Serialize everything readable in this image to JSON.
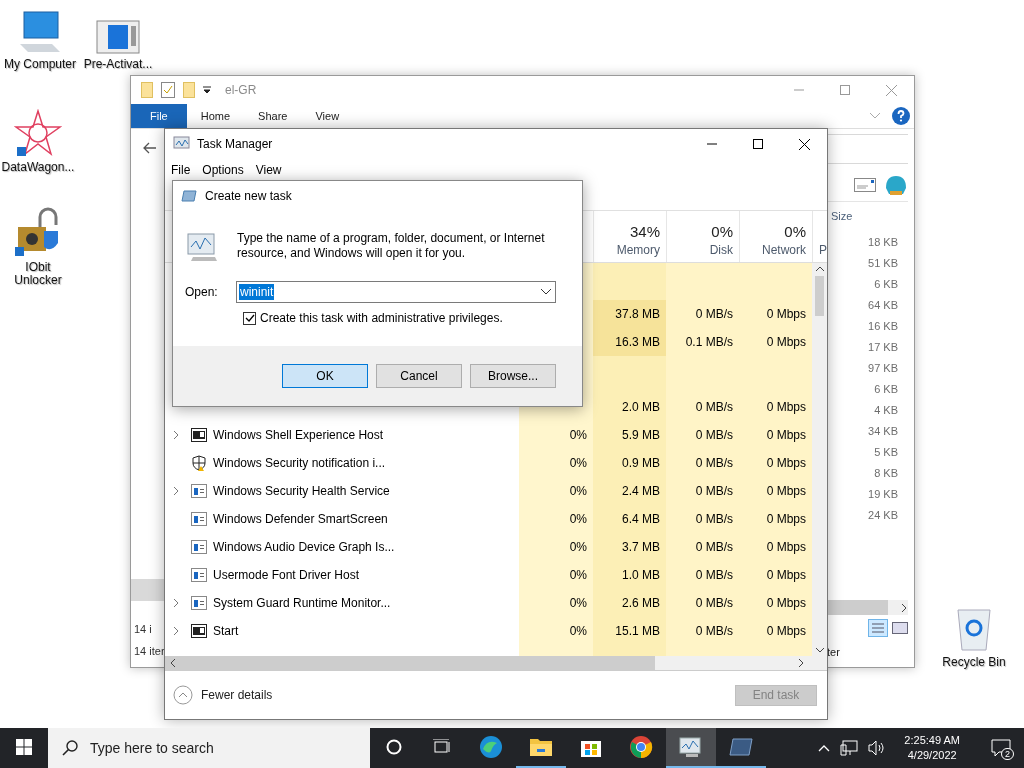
{
  "desktop_icons": [
    {
      "label": "My Computer",
      "kind": "computer"
    },
    {
      "label": "Pre-Activat...",
      "kind": "window"
    },
    {
      "label": "DataWagon...",
      "kind": "star"
    },
    {
      "label": "IObit Unlocker",
      "kind": "lock"
    },
    {
      "label": "Recycle Bin",
      "kind": "bin"
    }
  ],
  "explorer": {
    "title": "el-GR",
    "ribbon_tabs": [
      {
        "label": "File",
        "selected": true
      },
      {
        "label": "Home",
        "selected": false
      },
      {
        "label": "Share",
        "selected": false
      },
      {
        "label": "View",
        "selected": false
      }
    ],
    "size_header": "Size",
    "sizes": [
      "18 KB",
      "51 KB",
      "6 KB",
      "64 KB",
      "16 KB",
      "17 KB",
      "97 KB",
      "6 KB",
      "4 KB",
      "34 KB",
      "5 KB",
      "8 KB",
      "19 KB",
      "24 KB"
    ],
    "left_count": "14 i",
    "status_left": "14 iter",
    "status_right": "ter"
  },
  "task_manager": {
    "title": "Task Manager",
    "menu": [
      "File",
      "Options",
      "View"
    ],
    "columns": [
      {
        "percent": "34%",
        "label": "Memory"
      },
      {
        "percent": "0%",
        "label": "Disk"
      },
      {
        "percent": "0%",
        "label": "Network"
      }
    ],
    "cut_column": "P",
    "groups": [
      {
        "rows": [
          {
            "memory": "37.8 MB",
            "disk": "0 MB/s",
            "network": "0 Mbps"
          },
          {
            "memory": "16.3 MB",
            "disk": "0.1 MB/s",
            "network": "0 Mbps"
          }
        ]
      },
      {
        "rows": [
          {
            "memory": "2.0 MB",
            "disk": "0 MB/s",
            "network": "0 Mbps"
          },
          {
            "name": "Windows Shell Experience Host",
            "kind": "app",
            "expandable": true,
            "cpu": "0%",
            "memory": "5.9 MB",
            "disk": "0 MB/s",
            "network": "0 Mbps"
          },
          {
            "name": "Windows Security notification i...",
            "kind": "shield",
            "expandable": false,
            "cpu": "0%",
            "memory": "0.9 MB",
            "disk": "0 MB/s",
            "network": "0 Mbps"
          },
          {
            "name": "Windows Security Health Service",
            "kind": "service",
            "expandable": true,
            "cpu": "0%",
            "memory": "2.4 MB",
            "disk": "0 MB/s",
            "network": "0 Mbps"
          },
          {
            "name": "Windows Defender SmartScreen",
            "kind": "service",
            "expandable": false,
            "cpu": "0%",
            "memory": "6.4 MB",
            "disk": "0 MB/s",
            "network": "0 Mbps"
          },
          {
            "name": "Windows Audio Device Graph Is...",
            "kind": "service",
            "expandable": false,
            "cpu": "0%",
            "memory": "3.7 MB",
            "disk": "0 MB/s",
            "network": "0 Mbps"
          },
          {
            "name": "Usermode Font Driver Host",
            "kind": "service",
            "expandable": false,
            "cpu": "0%",
            "memory": "1.0 MB",
            "disk": "0 MB/s",
            "network": "0 Mbps"
          },
          {
            "name": "System Guard Runtime Monitor...",
            "kind": "service",
            "expandable": true,
            "cpu": "0%",
            "memory": "2.6 MB",
            "disk": "0 MB/s",
            "network": "0 Mbps"
          },
          {
            "name": "Start",
            "kind": "app",
            "expandable": true,
            "cpu": "0%",
            "memory": "15.1 MB",
            "disk": "0 MB/s",
            "network": "0 Mbps"
          }
        ]
      }
    ],
    "fewer_details": "Fewer details",
    "end_task": {
      "label": "End task",
      "disabled": true
    }
  },
  "dialog": {
    "title": "Create new task",
    "message": "Type the name of a program, folder, document, or Internet resource, and Windows will open it for you.",
    "open_label": "Open:",
    "open_value": "wininit",
    "admin_checkbox": {
      "label": "Create this task with administrative privileges.",
      "checked": true
    },
    "buttons": [
      {
        "label": "OK",
        "default": true
      },
      {
        "label": "Cancel",
        "default": false
      },
      {
        "label": "Browse...",
        "default": false
      }
    ]
  },
  "taskbar": {
    "search_placeholder": "Type here to search",
    "apps": [
      {
        "kind": "edge",
        "running": false,
        "selected": false
      },
      {
        "kind": "folder",
        "running": true,
        "selected": false
      },
      {
        "kind": "store",
        "running": false,
        "selected": false
      },
      {
        "kind": "chrome",
        "running": false,
        "selected": false
      },
      {
        "kind": "monitor",
        "running": true,
        "selected": true
      },
      {
        "kind": "slate",
        "running": true,
        "selected": false
      }
    ],
    "time": "2:25:49 AM",
    "date": "4/29/2022",
    "notification_count": "2"
  }
}
